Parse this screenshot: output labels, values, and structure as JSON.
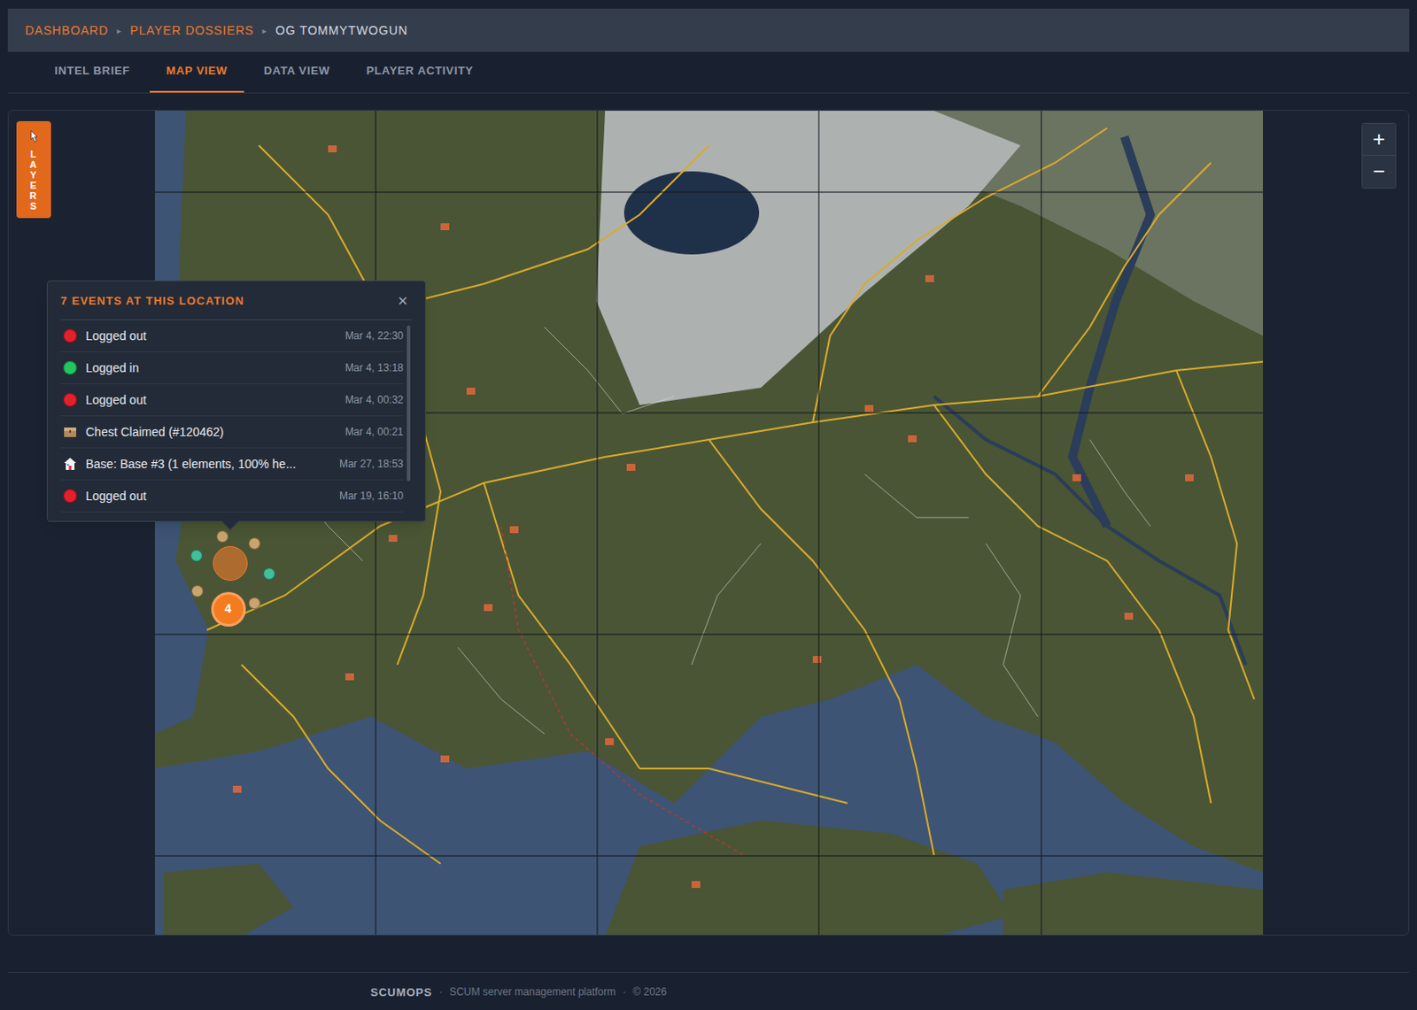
{
  "breadcrumbs": [
    {
      "label": "DASHBOARD",
      "link": true
    },
    {
      "label": "PLAYER DOSSIERS",
      "link": true
    },
    {
      "label": "OG TOMMYTWOGUN",
      "link": false
    }
  ],
  "breadcrumb_separator": "▸",
  "tabs": [
    {
      "label": "INTEL BRIEF",
      "selected": false
    },
    {
      "label": "MAP VIEW",
      "selected": true
    },
    {
      "label": "DATA VIEW",
      "selected": false
    },
    {
      "label": "PLAYER ACTIVITY",
      "selected": false
    }
  ],
  "layers_button": {
    "label": "LAYERS"
  },
  "zoom": {
    "in": "+",
    "out": "−"
  },
  "popup": {
    "title": "7 EVENTS AT THIS LOCATION",
    "close": "✕",
    "events": [
      {
        "kind": "status",
        "label": "Logged out",
        "time": "Mar 4, 22:30",
        "color": "#e5202a"
      },
      {
        "kind": "status",
        "label": "Logged in",
        "time": "Mar 4, 13:18",
        "color": "#22c55e"
      },
      {
        "kind": "status",
        "label": "Logged out",
        "time": "Mar 4, 00:32",
        "color": "#e5202a"
      },
      {
        "kind": "chest",
        "label": "Chest Claimed (#120462)",
        "time": "Mar 4, 00:21"
      },
      {
        "kind": "base",
        "label": "Base: Base #3 (1 elements, 100% he...",
        "time": "Mar 27, 18:53"
      },
      {
        "kind": "status",
        "label": "Logged out",
        "time": "Mar 19, 16:10",
        "color": "#e5202a"
      }
    ]
  },
  "map": {
    "cluster": {
      "count": "4"
    },
    "markers": [
      {
        "color": "#c9a46c"
      },
      {
        "color": "#c9a46c"
      },
      {
        "color": "#c9a46c"
      },
      {
        "color": "#c9a46c"
      },
      {
        "color": "#3fbf9a"
      },
      {
        "color": "#3fbf9a"
      }
    ]
  },
  "footer": {
    "brand": "SCUMOPS",
    "separator": "·",
    "tagline": "SCUM server management platform",
    "copyright": "© 2026"
  }
}
